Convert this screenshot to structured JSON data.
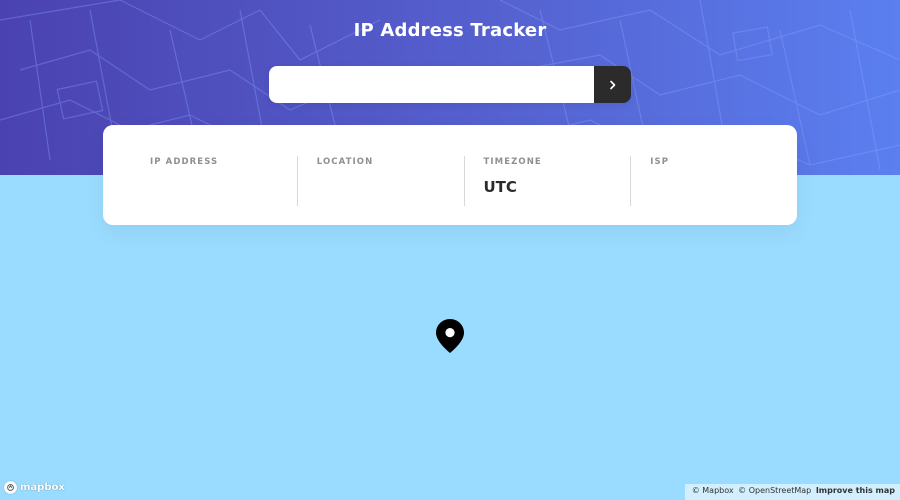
{
  "header": {
    "title": "IP Address Tracker"
  },
  "search": {
    "value": "",
    "placeholder": ""
  },
  "info": {
    "items": [
      {
        "label": "IP ADDRESS",
        "value": ""
      },
      {
        "label": "LOCATION",
        "value": ""
      },
      {
        "label": "TIMEZONE",
        "value": "UTC"
      },
      {
        "label": "ISP",
        "value": ""
      }
    ]
  },
  "map": {
    "logo_text": "mapbox",
    "attribution_mapbox": "© Mapbox",
    "attribution_osm": "© OpenStreetMap",
    "attribution_improve": "Improve this map"
  },
  "icons": {
    "search_submit": "chevron-right-icon",
    "location_pin": "location-pin-icon"
  },
  "colors": {
    "header_gradient_left": "#4a42b0",
    "header_gradient_right": "#5b7ff0",
    "map_background": "#9adcff",
    "dark_button": "#2b2b2b",
    "card_background": "#ffffff"
  }
}
